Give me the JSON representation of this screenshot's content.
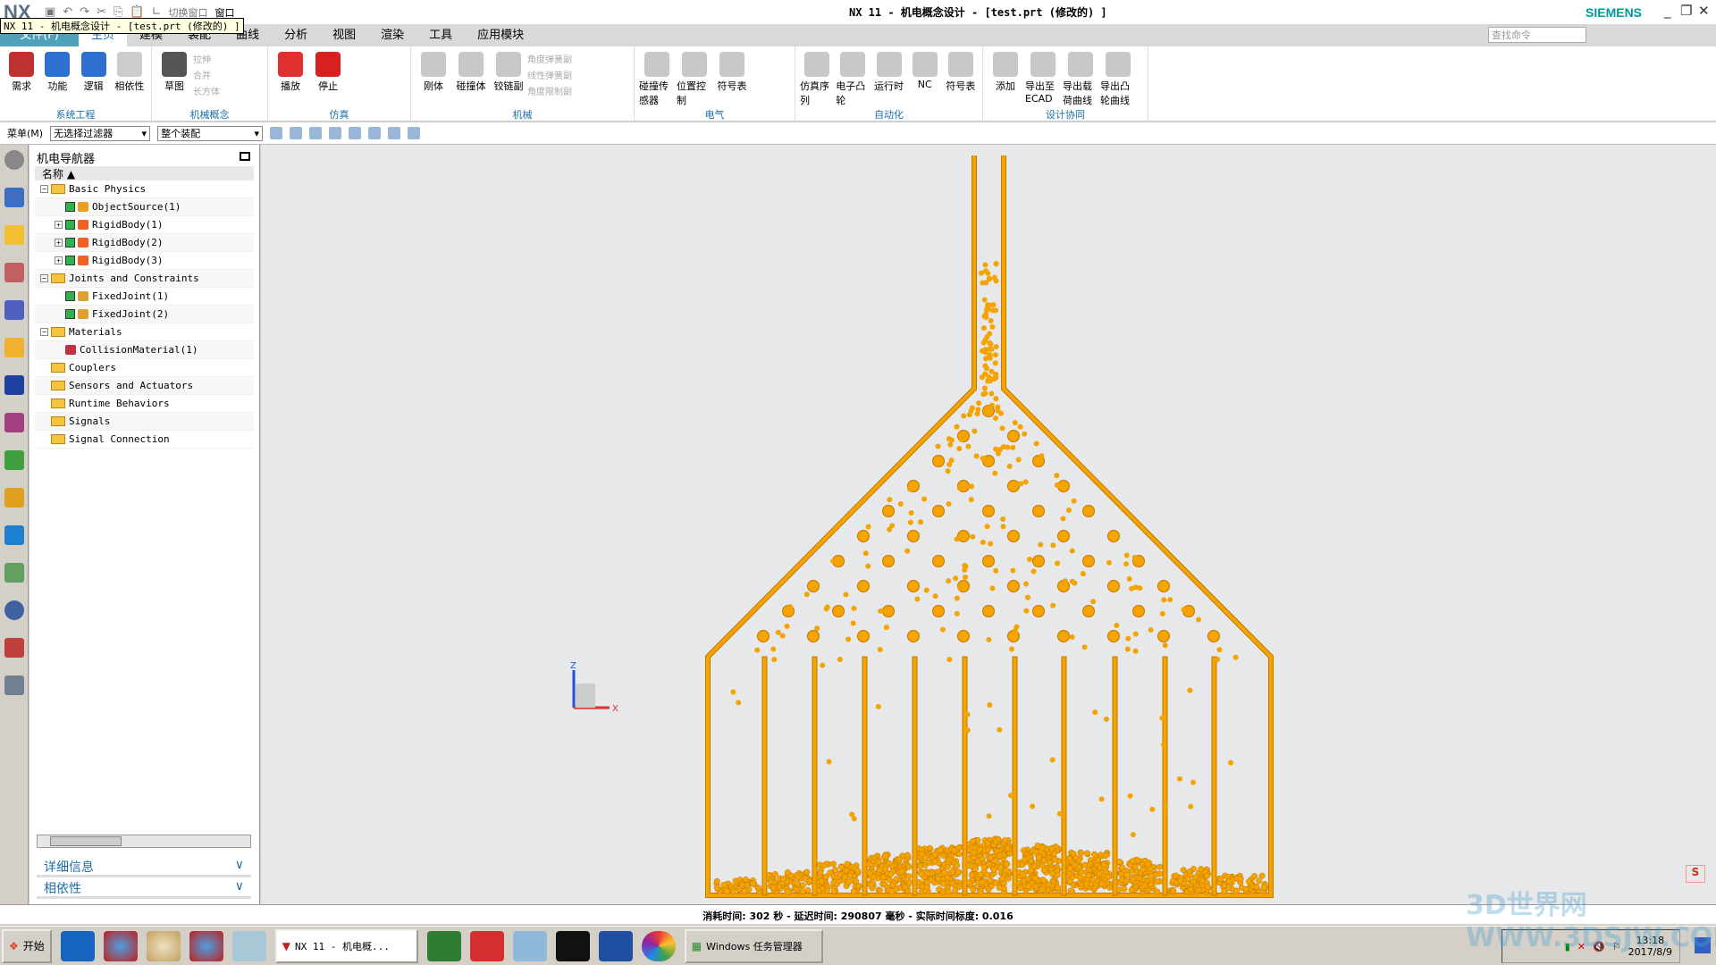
{
  "window": {
    "app_logo": "NX",
    "title": "NX 11 - 机电概念设计 - [test.prt (修改的) ]",
    "tooltip": "NX 11 - 机电概念设计 - [test.prt (修改的) ]",
    "brand": "SIEMENS",
    "quick_access": [
      "切换窗口",
      "窗口"
    ]
  },
  "tabs": [
    "文件(F)",
    "主页",
    "建模",
    "装配",
    "曲线",
    "分析",
    "视图",
    "渲染",
    "工具",
    "应用模块"
  ],
  "search_placeholder": "查找命令",
  "ribbon": [
    {
      "label": "系统工程",
      "buttons": [
        "需求",
        "功能",
        "逻辑",
        "相依性"
      ]
    },
    {
      "label": "机械概念",
      "buttons": [
        "草图"
      ],
      "small": [
        "拉伸",
        "合并",
        "长方体"
      ]
    },
    {
      "label": "仿真",
      "buttons": [
        "播放",
        "停止"
      ]
    },
    {
      "label": "机械",
      "buttons": [
        "刚体",
        "碰撞体",
        "铰链副"
      ],
      "small": [
        "角度弹簧副",
        "线性弹簧副",
        "角度限制副"
      ]
    },
    {
      "label": "电气",
      "buttons": [
        "碰撞传感器",
        "位置控制",
        "符号表"
      ]
    },
    {
      "label": "自动化",
      "buttons": [
        "仿真序列",
        "电子凸轮",
        "运行时",
        "NC",
        "符号表"
      ]
    },
    {
      "label": "设计协同",
      "buttons": [
        "添加",
        "导出至ECAD",
        "导出载荷曲线",
        "导出凸轮曲线"
      ]
    }
  ],
  "toolbar": {
    "menu": "菜单(M)",
    "filter": "无选择过滤器",
    "scope": "整个装配"
  },
  "navigator": {
    "title": "机电导航器",
    "column": "名称",
    "items": [
      {
        "label": "Basic Physics",
        "type": "folder",
        "level": 0,
        "exp": "-"
      },
      {
        "label": "ObjectSource(1)",
        "type": "source",
        "level": 1,
        "checked": true
      },
      {
        "label": "RigidBody(1)",
        "type": "rigid",
        "level": 1,
        "checked": true,
        "exp": "+"
      },
      {
        "label": "RigidBody(2)",
        "type": "rigid",
        "level": 1,
        "checked": true,
        "exp": "+"
      },
      {
        "label": "RigidBody(3)",
        "type": "rigid",
        "level": 1,
        "checked": true,
        "exp": "+"
      },
      {
        "label": "Joints and Constraints",
        "type": "folder",
        "level": 0,
        "exp": "-"
      },
      {
        "label": "FixedJoint(1)",
        "type": "joint",
        "level": 1,
        "checked": true
      },
      {
        "label": "FixedJoint(2)",
        "type": "joint",
        "level": 1,
        "checked": true
      },
      {
        "label": "Materials",
        "type": "folder",
        "level": 0,
        "exp": "-"
      },
      {
        "label": "CollisionMaterial(1)",
        "type": "material",
        "level": 1
      },
      {
        "label": "Couplers",
        "type": "folder",
        "level": 0
      },
      {
        "label": "Sensors and Actuators",
        "type": "folder",
        "level": 0
      },
      {
        "label": "Runtime Behaviors",
        "type": "folder",
        "level": 0
      },
      {
        "label": "Signals",
        "type": "folder",
        "level": 0
      },
      {
        "label": "Signal Connection",
        "type": "folder",
        "level": 0
      }
    ],
    "details": "详细信息",
    "dependencies": "相依性"
  },
  "viewport": {
    "axis_z": "Z",
    "axis_x": "X",
    "model_color": "#f5a300"
  },
  "status": "消耗时间: 302 秒 - 延迟时间: 290807 毫秒 - 实际时间标度: 0.016",
  "taskbar": {
    "start": "开始",
    "nx_task": "NX 11 - 机电概...",
    "taskmgr": "Windows 任务管理器",
    "time": "13:18",
    "date": "2017/8/9"
  },
  "watermark": "3D世界网 WWW.3DSJW.COM"
}
